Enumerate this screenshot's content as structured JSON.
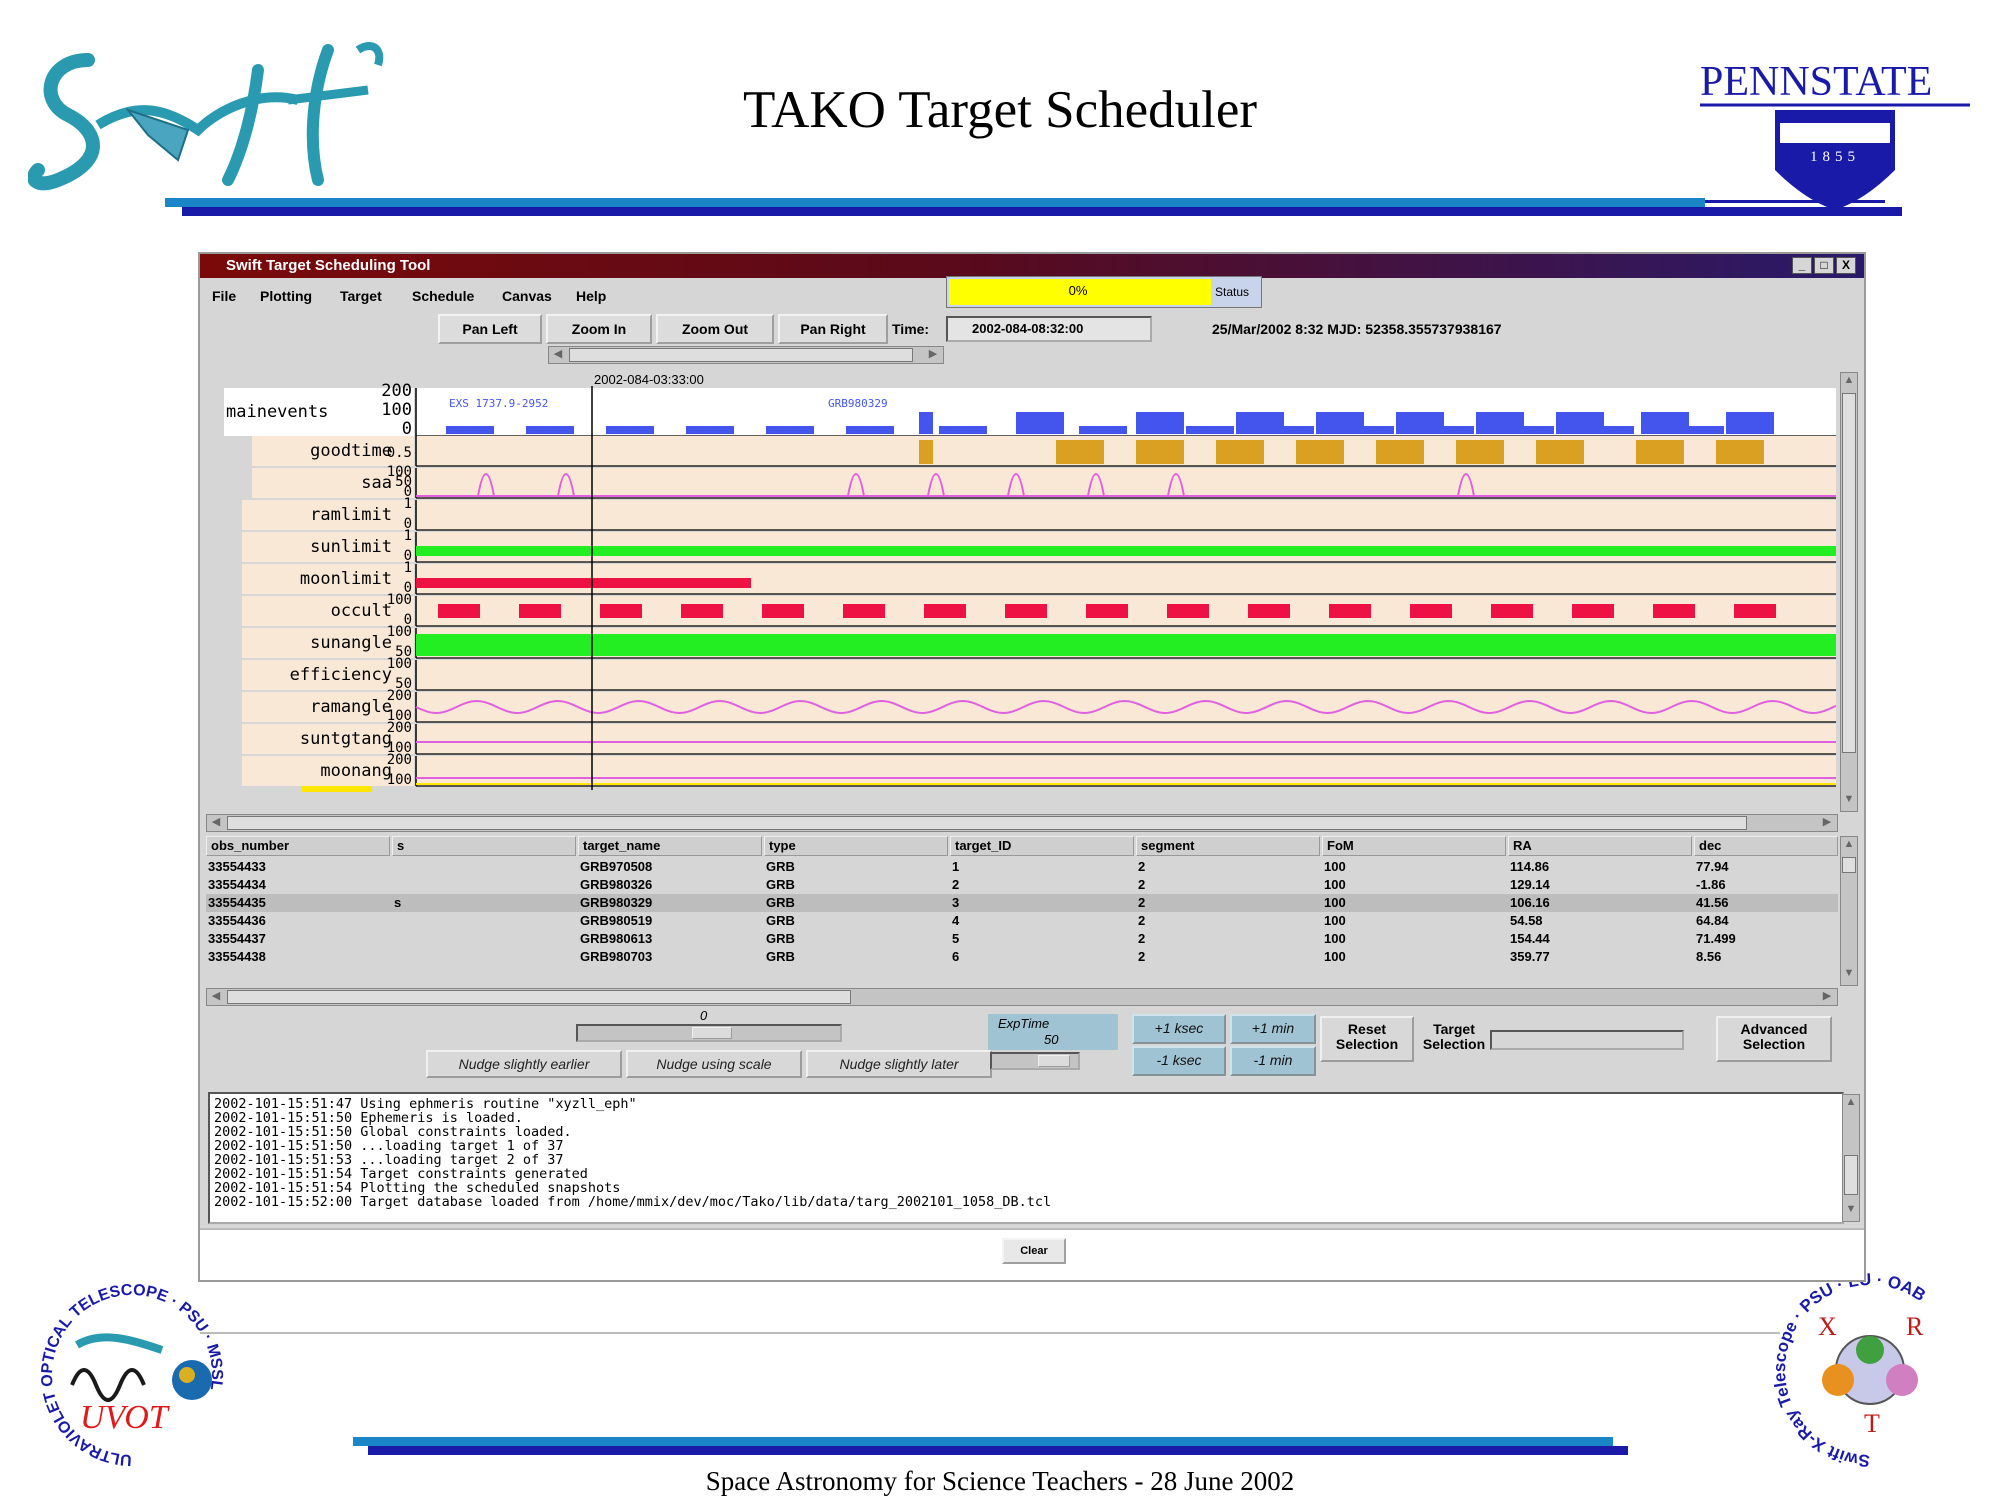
{
  "slide": {
    "title": "TAKO Target Scheduler",
    "footer": "Space Astronomy for Science Teachers -  28 June 2002",
    "logos": {
      "swift": "Swift",
      "pennstate": "PENNSTATE",
      "pennstate_year": "1855",
      "uvot_ring": "ULTRAVIOLET OPTICAL TELESCOPE · PSU · MSSL",
      "uvot": "UVOT",
      "xrt_ring": "Swift X-Ray Telescope · PSU · LU · OAB"
    },
    "colors": {
      "accent_blue": "#1a86c8",
      "dark_blue": "#1a1aa8",
      "teal": "#2a9ab0"
    }
  },
  "window": {
    "title": "Swift Target Scheduling Tool",
    "controls": [
      "_",
      "□",
      "X"
    ],
    "menu": [
      "File",
      "Plotting",
      "Target",
      "Schedule",
      "Canvas",
      "Help"
    ],
    "progress": {
      "text": "0%",
      "value": 0,
      "status_label": "Status"
    },
    "toolbar": [
      "Pan Left",
      "Zoom In",
      "Zoom Out",
      "Pan Right"
    ],
    "time_label": "Time:",
    "time_value": "2002-084-08:32:00",
    "time_readout": "25/Mar/2002 8:32  MJD: 52358.355737938167",
    "cursor_time": "2002-084-03:33:00"
  },
  "timeline": {
    "event_labels": [
      "EXS 1737.9-2952",
      "GRB980329"
    ],
    "rows": [
      {
        "name": "mainevents",
        "ticks": [
          "200",
          "100",
          "0"
        ],
        "bg": "#ffffff",
        "kind": "mainevents",
        "color": "#4455ee"
      },
      {
        "name": "goodtime",
        "ticks": [
          "0.5"
        ],
        "bg": "#fae8d6",
        "kind": "goodtime",
        "color": "#d9a021"
      },
      {
        "name": "saa",
        "ticks": [
          "100",
          "50",
          "0"
        ],
        "bg": "#fae8d6",
        "kind": "saa",
        "color": "#e060e0"
      },
      {
        "name": "ramlimit",
        "ticks": [
          "1",
          "0"
        ],
        "bg": "#fae8d6",
        "kind": "flat",
        "color": "#000000"
      },
      {
        "name": "sunlimit",
        "ticks": [
          "1",
          "0"
        ],
        "bg": "#fae8d6",
        "kind": "sunlimit",
        "color": "#22ee22"
      },
      {
        "name": "moonlimit",
        "ticks": [
          "1",
          "0"
        ],
        "bg": "#fae8d6",
        "kind": "moonlimit",
        "color": "#ee1144"
      },
      {
        "name": "occult",
        "ticks": [
          "100",
          "0"
        ],
        "bg": "#fae8d6",
        "kind": "occult",
        "color": "#ee1144"
      },
      {
        "name": "sunangle",
        "ticks": [
          "100",
          "50"
        ],
        "bg": "#fae8d6",
        "kind": "sunangle",
        "color": "#22ee22"
      },
      {
        "name": "efficiency",
        "ticks": [
          "100",
          "50"
        ],
        "bg": "#fae8d6",
        "kind": "flat",
        "color": "#000000"
      },
      {
        "name": "ramangle",
        "ticks": [
          "200",
          "100"
        ],
        "bg": "#fae8d6",
        "kind": "ramangle",
        "color": "#e060e0"
      },
      {
        "name": "suntgtang",
        "ticks": [
          "200",
          "100"
        ],
        "bg": "#fae8d6",
        "kind": "suntgtang",
        "color": "#e060e0"
      },
      {
        "name": "moonang",
        "ticks": [
          "200",
          "100"
        ],
        "bg": "#fae8d6",
        "kind": "moonang",
        "color": "#e060e0"
      }
    ]
  },
  "table": {
    "columns": [
      "obs_number",
      "s",
      "target_name",
      "type",
      "target_ID",
      "segment",
      "FoM",
      "RA",
      "dec"
    ],
    "rows": [
      [
        "33554433",
        "",
        "GRB970508",
        "GRB",
        "1",
        "2",
        "100",
        "114.86",
        "77.94"
      ],
      [
        "33554434",
        "",
        "GRB980326",
        "GRB",
        "2",
        "2",
        "100",
        "129.14",
        "-1.86"
      ],
      [
        "33554435",
        "s",
        "GRB980329",
        "GRB",
        "3",
        "2",
        "100",
        "106.16",
        "41.56"
      ],
      [
        "33554436",
        "",
        "GRB980519",
        "GRB",
        "4",
        "2",
        "100",
        "54.58",
        "64.84"
      ],
      [
        "33554437",
        "",
        "GRB980613",
        "GRB",
        "5",
        "2",
        "100",
        "154.44",
        "71.499"
      ],
      [
        "33554438",
        "",
        "GRB980703",
        "GRB",
        "6",
        "2",
        "100",
        "359.77",
        "8.56"
      ]
    ],
    "selected_row": 2
  },
  "controls": {
    "slider_value": "0",
    "nudge_earlier": "Nudge slightly earlier",
    "nudge_scale": "Nudge using scale",
    "nudge_later": "Nudge slightly later",
    "exptime_label": "ExpTime",
    "exptime_value": "50",
    "plus_ksec": "+1 ksec",
    "minus_ksec": "-1 ksec",
    "plus_min": "+1 min",
    "minus_min": "-1 min",
    "reset_selection": "Reset Selection",
    "target_selection": "Target Selection",
    "advanced_selection": "Advanced Selection"
  },
  "log": [
    "2002-101-15:51:47 Using ephmeris routine \"xyzll_eph\"",
    "2002-101-15:51:50 Ephemeris is loaded.",
    "2002-101-15:51:50 Global constraints loaded.",
    "2002-101-15:51:50 ...loading target 1 of 37",
    "2002-101-15:51:53 ...loading target 2 of 37",
    "2002-101-15:51:54 Target constraints generated",
    "2002-101-15:51:54 Plotting the scheduled snapshots",
    "2002-101-15:52:00 Target database loaded from /home/mmix/dev/moc/Tako/lib/data/targ_2002101_1058_DB.tcl"
  ],
  "clear_label": "Clear"
}
